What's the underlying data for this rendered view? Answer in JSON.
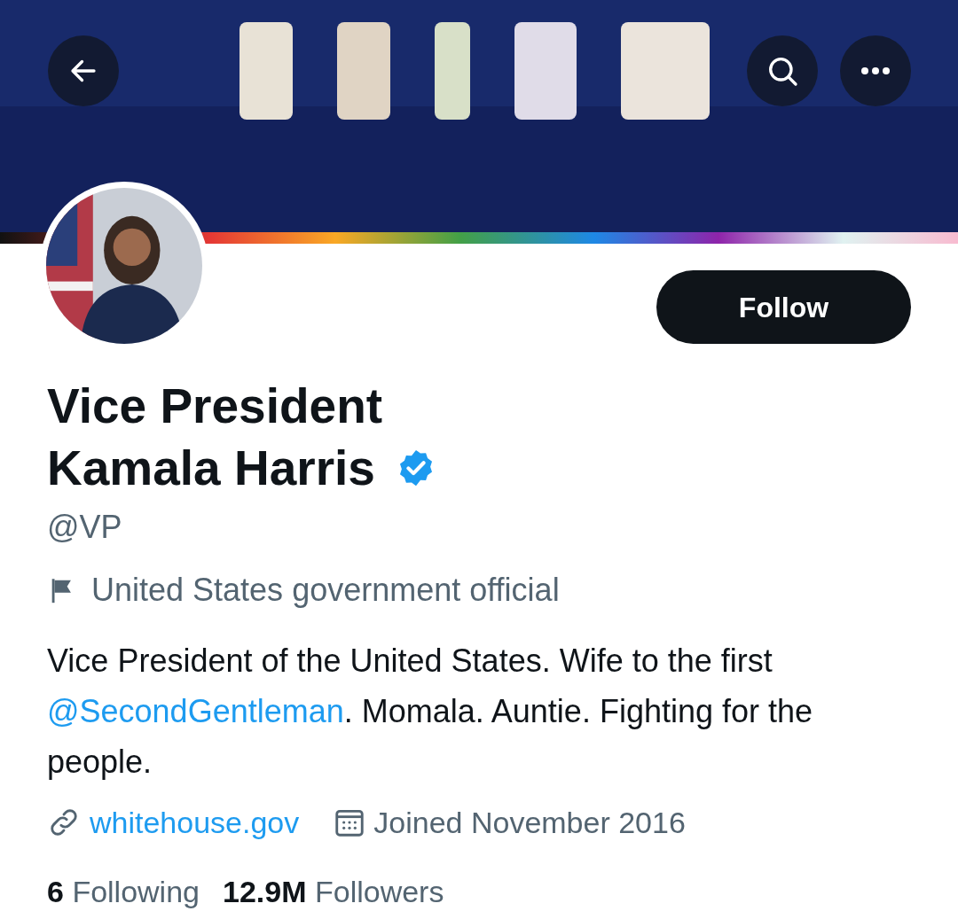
{
  "profile": {
    "follow_button": "Follow",
    "name": "Vice President Kamala Harris",
    "verified": true,
    "handle": "@VP",
    "category": "United States government official",
    "bio": {
      "lead": "Vice President of the United States. Wife to the first",
      "mention": "@SecondGentleman",
      "tail": ". Momala. Auntie. Fighting for the people."
    },
    "website": "whitehouse.gov",
    "joined": "Joined November 2016",
    "stats": [
      {
        "count": "6",
        "label": "Following"
      },
      {
        "count": "12.9M",
        "label": "Followers"
      }
    ]
  }
}
